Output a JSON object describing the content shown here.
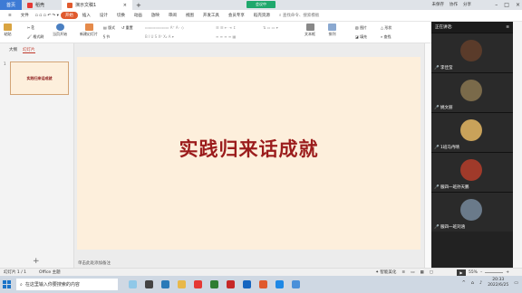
{
  "tabs": {
    "home": "首页",
    "doc": "稻壳",
    "active": "演示文稿1"
  },
  "meeting_label": "会议中",
  "menus": [
    "文件",
    "开始",
    "插入",
    "设计",
    "切换",
    "动画",
    "放映",
    "审阅",
    "视图",
    "开发工具",
    "会员专享",
    "稻壳资源",
    "查找命令、搜索模板"
  ],
  "menus_ribbon": [
    "开始",
    "插入",
    "设计",
    "切换",
    "动画",
    "放映",
    "审阅",
    "视图",
    "开发工具",
    "会员专享",
    "稻壳资源",
    "查找命令"
  ],
  "menu_actions": [
    "未保存",
    "协作",
    "分享"
  ],
  "ribbon": {
    "paste": "粘贴",
    "format_painter": "格式刷",
    "from_current": "当页开始",
    "new_slide": "新建幻灯片",
    "layout": "版式",
    "section": "节",
    "reset": "重置",
    "textbox": "文本框",
    "arrange": "排列",
    "picture": "图片",
    "fill": "填充",
    "shapes": "形状",
    "find": "查找"
  },
  "panel_tabs": {
    "outline": "大纲",
    "slides": "幻灯片"
  },
  "thumbnail_text": "实践归来话成就",
  "slide_title": "实践归来话成就",
  "notes_placeholder": "单击此处添加备注",
  "status": {
    "slide_counter": "幻灯片 1 / 1",
    "theme": "Office 主题",
    "beautify": "智能美化",
    "zoom": "55%"
  },
  "video_panel": {
    "title": "正在讲话:",
    "participants": [
      {
        "name": "李佳莹",
        "color": "#5a3b2a"
      },
      {
        "name": "姚文丽",
        "color": "#7a6a4a"
      },
      {
        "name": "1班马冉晴",
        "color": "#c9a25a"
      },
      {
        "name": "服四一班孙天鹏",
        "color": "#a03a2a"
      },
      {
        "name": "服四一班刘涵",
        "color": "#6a7a8a"
      }
    ]
  },
  "taskbar": {
    "search_placeholder": "在这里输入你要搜索的内容",
    "time": "20:33",
    "date": "2022/6/25"
  },
  "colors": {
    "slide_bg": "#fdefdc",
    "title": "#9b1c1c",
    "accent": "#e05a2e",
    "tab_home": "#3d7bd5",
    "meeting": "#1fa86c"
  }
}
